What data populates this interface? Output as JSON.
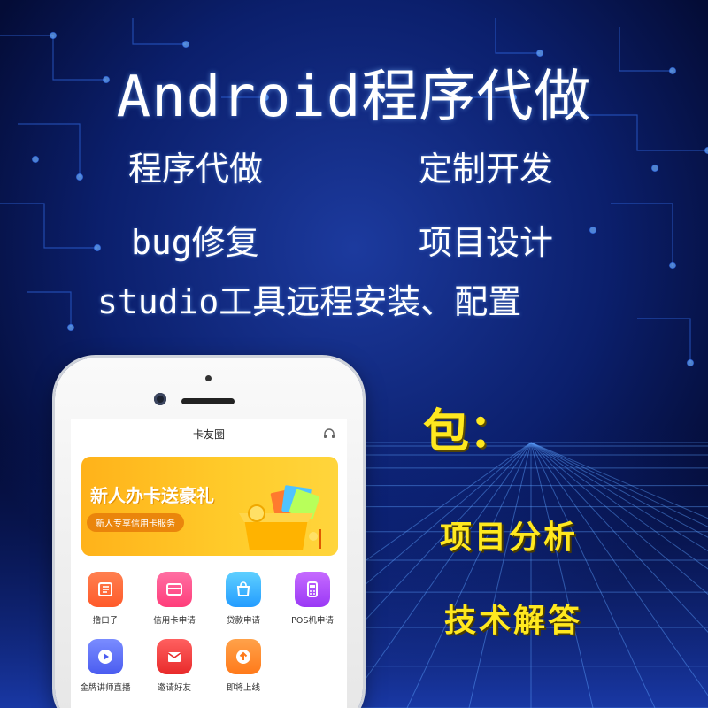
{
  "headline": "Android程序代做",
  "services": [
    "程序代做",
    "定制开发",
    "bug修复",
    "项目设计",
    "studio工具远程安装、配置"
  ],
  "package": {
    "title": "包：",
    "items": [
      "项目分析",
      "技术解答"
    ]
  },
  "phone_screen": {
    "nav_title": "卡友圈",
    "banner": {
      "headline": "新人办卡送豪礼",
      "subtitle": "新人专享信用卡服务"
    },
    "apps": [
      {
        "label": "撸口子",
        "icon": "document-icon",
        "color": "#ff6a3d"
      },
      {
        "label": "信用卡申请",
        "icon": "card-icon",
        "color": "#ff4f8b"
      },
      {
        "label": "贷款申请",
        "icon": "bag-icon",
        "color": "#35b9ff"
      },
      {
        "label": "POS机申请",
        "icon": "pos-icon",
        "color": "#b04bff"
      },
      {
        "label": "金牌讲师直播",
        "icon": "play-icon",
        "color": "#5b6cff"
      },
      {
        "label": "邀请好友",
        "icon": "envelope-icon",
        "color": "#ff3d3d"
      },
      {
        "label": "即将上线",
        "icon": "upload-icon",
        "color": "#ff8a2a"
      }
    ]
  },
  "colors": {
    "background": "#06134a",
    "package_text": "#ffe81f",
    "banner": "#ffc21f"
  }
}
